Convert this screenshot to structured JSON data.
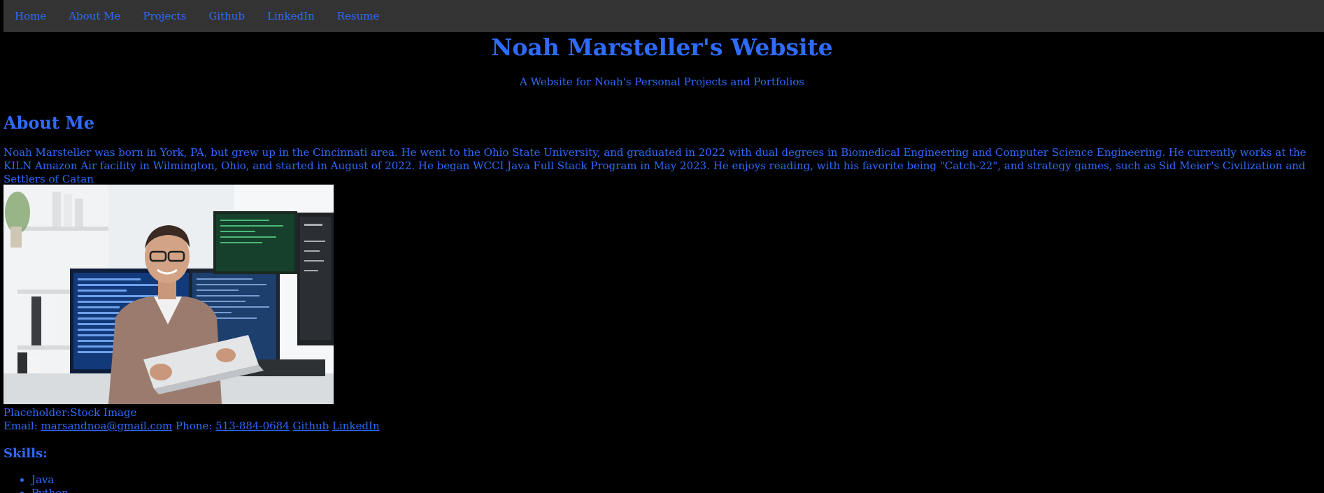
{
  "nav": {
    "items": [
      "Home",
      "About Me",
      "Projects",
      "Github",
      "LinkedIn",
      "Resume"
    ]
  },
  "header": {
    "title": "Noah Marsteller's Website",
    "subtitle": "A Website for Noah's Personal Projects and Portfolios"
  },
  "about": {
    "heading": "About Me",
    "bio": "Noah Marsteller was born in York, PA, but grew up in the Cincinnati area. He went to the Ohio State University, and graduated in 2022 with dual degrees in Biomedical Engineering and Computer Science Engineering. He currently works at the KILN Amazon Air facility in Wilmington, Ohio, and started in August of 2022. He began WCCI Java Full Stack Program in May 2023. He enjoys reading, with his favorite being \"Catch-22\", and strategy games, such as Sid Meier's Civilization and Settlers of Catan",
    "image_caption": "Placeholder:Stock Image"
  },
  "contact": {
    "email_label": "Email:",
    "email": "marsandnoa@gmail.com",
    "phone_label": "Phone:",
    "phone": "513-884-0684",
    "github": "Github",
    "linkedin": "LinkedIn"
  },
  "skills": {
    "heading": "Skills:",
    "items": [
      "Java",
      "Python"
    ]
  },
  "colors": {
    "background": "#000000",
    "navbar": "#333333",
    "text_accent": "#2e6bff"
  }
}
